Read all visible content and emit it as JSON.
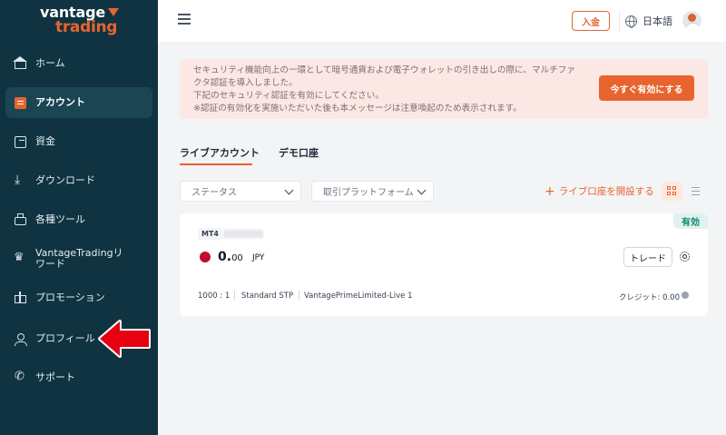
{
  "brand": {
    "line1": "vantage",
    "line2": "trading"
  },
  "sidebar": {
    "items": [
      {
        "label": "ホーム",
        "icon": "home-icon"
      },
      {
        "label": "アカウント",
        "icon": "account-icon",
        "active": true
      },
      {
        "label": "資金",
        "icon": "funds-icon"
      },
      {
        "label": "ダウンロード",
        "icon": "download-icon"
      },
      {
        "label": "各種ツール",
        "icon": "tools-icon"
      },
      {
        "label": "VantageTradingリワード",
        "icon": "reward-crown-icon"
      },
      {
        "label": "プロモーション",
        "icon": "promotion-gift-icon"
      },
      {
        "label": "プロフィール",
        "icon": "profile-icon"
      },
      {
        "label": "サポート",
        "icon": "support-icon"
      }
    ]
  },
  "header": {
    "deposit_label": "入金",
    "language_label": "日本語"
  },
  "banner": {
    "lines": [
      "セキュリティ機能向上の一環として暗号通貨および電子ウォレットの引き出しの際に、マルチファクタ認証を導入しました。",
      "下記のセキュリティ認証を有効にしてください。",
      "※認証の有効化を実施いただいた後も本メッセージは注意喚起のため表示されます。"
    ],
    "button_label": "今すぐ有効にする"
  },
  "tabs": [
    {
      "label": "ライブアカウント",
      "active": true
    },
    {
      "label": "デモ口座"
    }
  ],
  "filters": {
    "status_placeholder": "ステータス",
    "platform_placeholder": "取引プラットフォーム",
    "open_live_label": "ライブ口座を開設する"
  },
  "account": {
    "status": "有効",
    "platform": "MT4",
    "balance_main": "0.",
    "balance_decimals": "00",
    "currency": "JPY",
    "trade_label": "トレード",
    "leverage": "1000 : 1",
    "account_type": "Standard STP",
    "server": "VantagePrimeLimited-Live 1",
    "credit": "クレジット: 0.00"
  },
  "colors": {
    "sidebar_bg": "#0f3340",
    "accent": "#e8642f",
    "banner_bg": "#fbe8e4",
    "active_badge": "#0f8a72",
    "arrow_red": "#e60012"
  }
}
